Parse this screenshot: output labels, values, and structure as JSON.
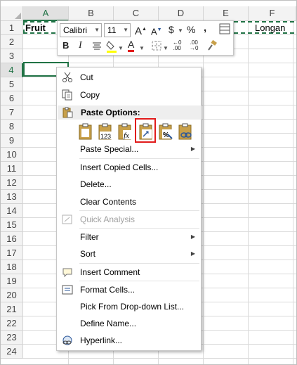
{
  "sheet": {
    "columns": [
      "A",
      "B",
      "C",
      "D",
      "E",
      "F"
    ],
    "rows": [
      "1",
      "2",
      "3",
      "4",
      "5",
      "6",
      "7",
      "8",
      "9",
      "10",
      "11",
      "12",
      "13",
      "14",
      "15",
      "16",
      "17",
      "18",
      "19",
      "20",
      "21",
      "22",
      "23",
      "24"
    ],
    "a1": "Fruit",
    "f1": "Longan"
  },
  "mini_toolbar": {
    "font_name": "Calibri",
    "font_size": "11",
    "grow_font": "A",
    "shrink_font": "A",
    "currency": "$",
    "percent": "%",
    "comma": ",",
    "bold": "B",
    "italic": "I",
    "font_color": "A"
  },
  "menu": {
    "cut": "Cut",
    "copy": "Copy",
    "paste_options": "Paste Options:",
    "paste_special": "Paste Special...",
    "insert_copied": "Insert Copied Cells...",
    "delete": "Delete...",
    "clear_contents": "Clear Contents",
    "quick_analysis": "Quick Analysis",
    "filter": "Filter",
    "sort": "Sort",
    "insert_comment": "Insert Comment",
    "format_cells": "Format Cells...",
    "pick_dropdown": "Pick From Drop-down List...",
    "define_name": "Define Name...",
    "hyperlink": "Hyperlink..."
  },
  "colors": {
    "excel_green": "#217346",
    "highlight_red": "#e11b1b",
    "icon_blue": "#2b579a",
    "icon_gold": "#c8a04a"
  }
}
